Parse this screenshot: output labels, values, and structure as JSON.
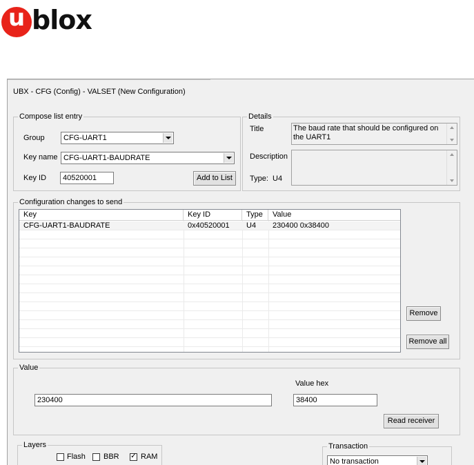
{
  "logo": {
    "u": "u",
    "rest": "blox"
  },
  "window": {
    "title": "UBX - CFG (Config) - VALSET (New Configuration)"
  },
  "compose": {
    "label": "Compose list entry",
    "group_label": "Group",
    "group_value": "CFG-UART1",
    "keyname_label": "Key name",
    "keyname_value": "CFG-UART1-BAUDRATE",
    "keyid_label": "Key ID",
    "keyid_value": "40520001",
    "add_button": "Add to List"
  },
  "details": {
    "label": "Details",
    "title_label": "Title",
    "title_value": "The baud rate that should be configured on the UART1",
    "description_label": "Description",
    "description_value": "",
    "type_label": "Type:",
    "type_value": "U4"
  },
  "changes": {
    "label": "Configuration changes to send",
    "columns": [
      "Key",
      "Key ID",
      "Type",
      "Value"
    ],
    "rows": [
      {
        "key": "CFG-UART1-BAUDRATE",
        "keyid": "0x40520001",
        "type": "U4",
        "value": "230400  0x38400"
      }
    ],
    "remove_button": "Remove",
    "remove_all_button": "Remove all"
  },
  "value": {
    "label": "Value",
    "value": "230400",
    "hex_label": "Value hex",
    "hex_value": "38400",
    "read_button": "Read receiver"
  },
  "layers": {
    "label": "Layers",
    "items": [
      {
        "label": "Flash",
        "checked": false
      },
      {
        "label": "BBR",
        "checked": false
      },
      {
        "label": "RAM",
        "checked": true
      }
    ]
  },
  "transaction": {
    "label": "Transaction",
    "value": "No transaction"
  }
}
